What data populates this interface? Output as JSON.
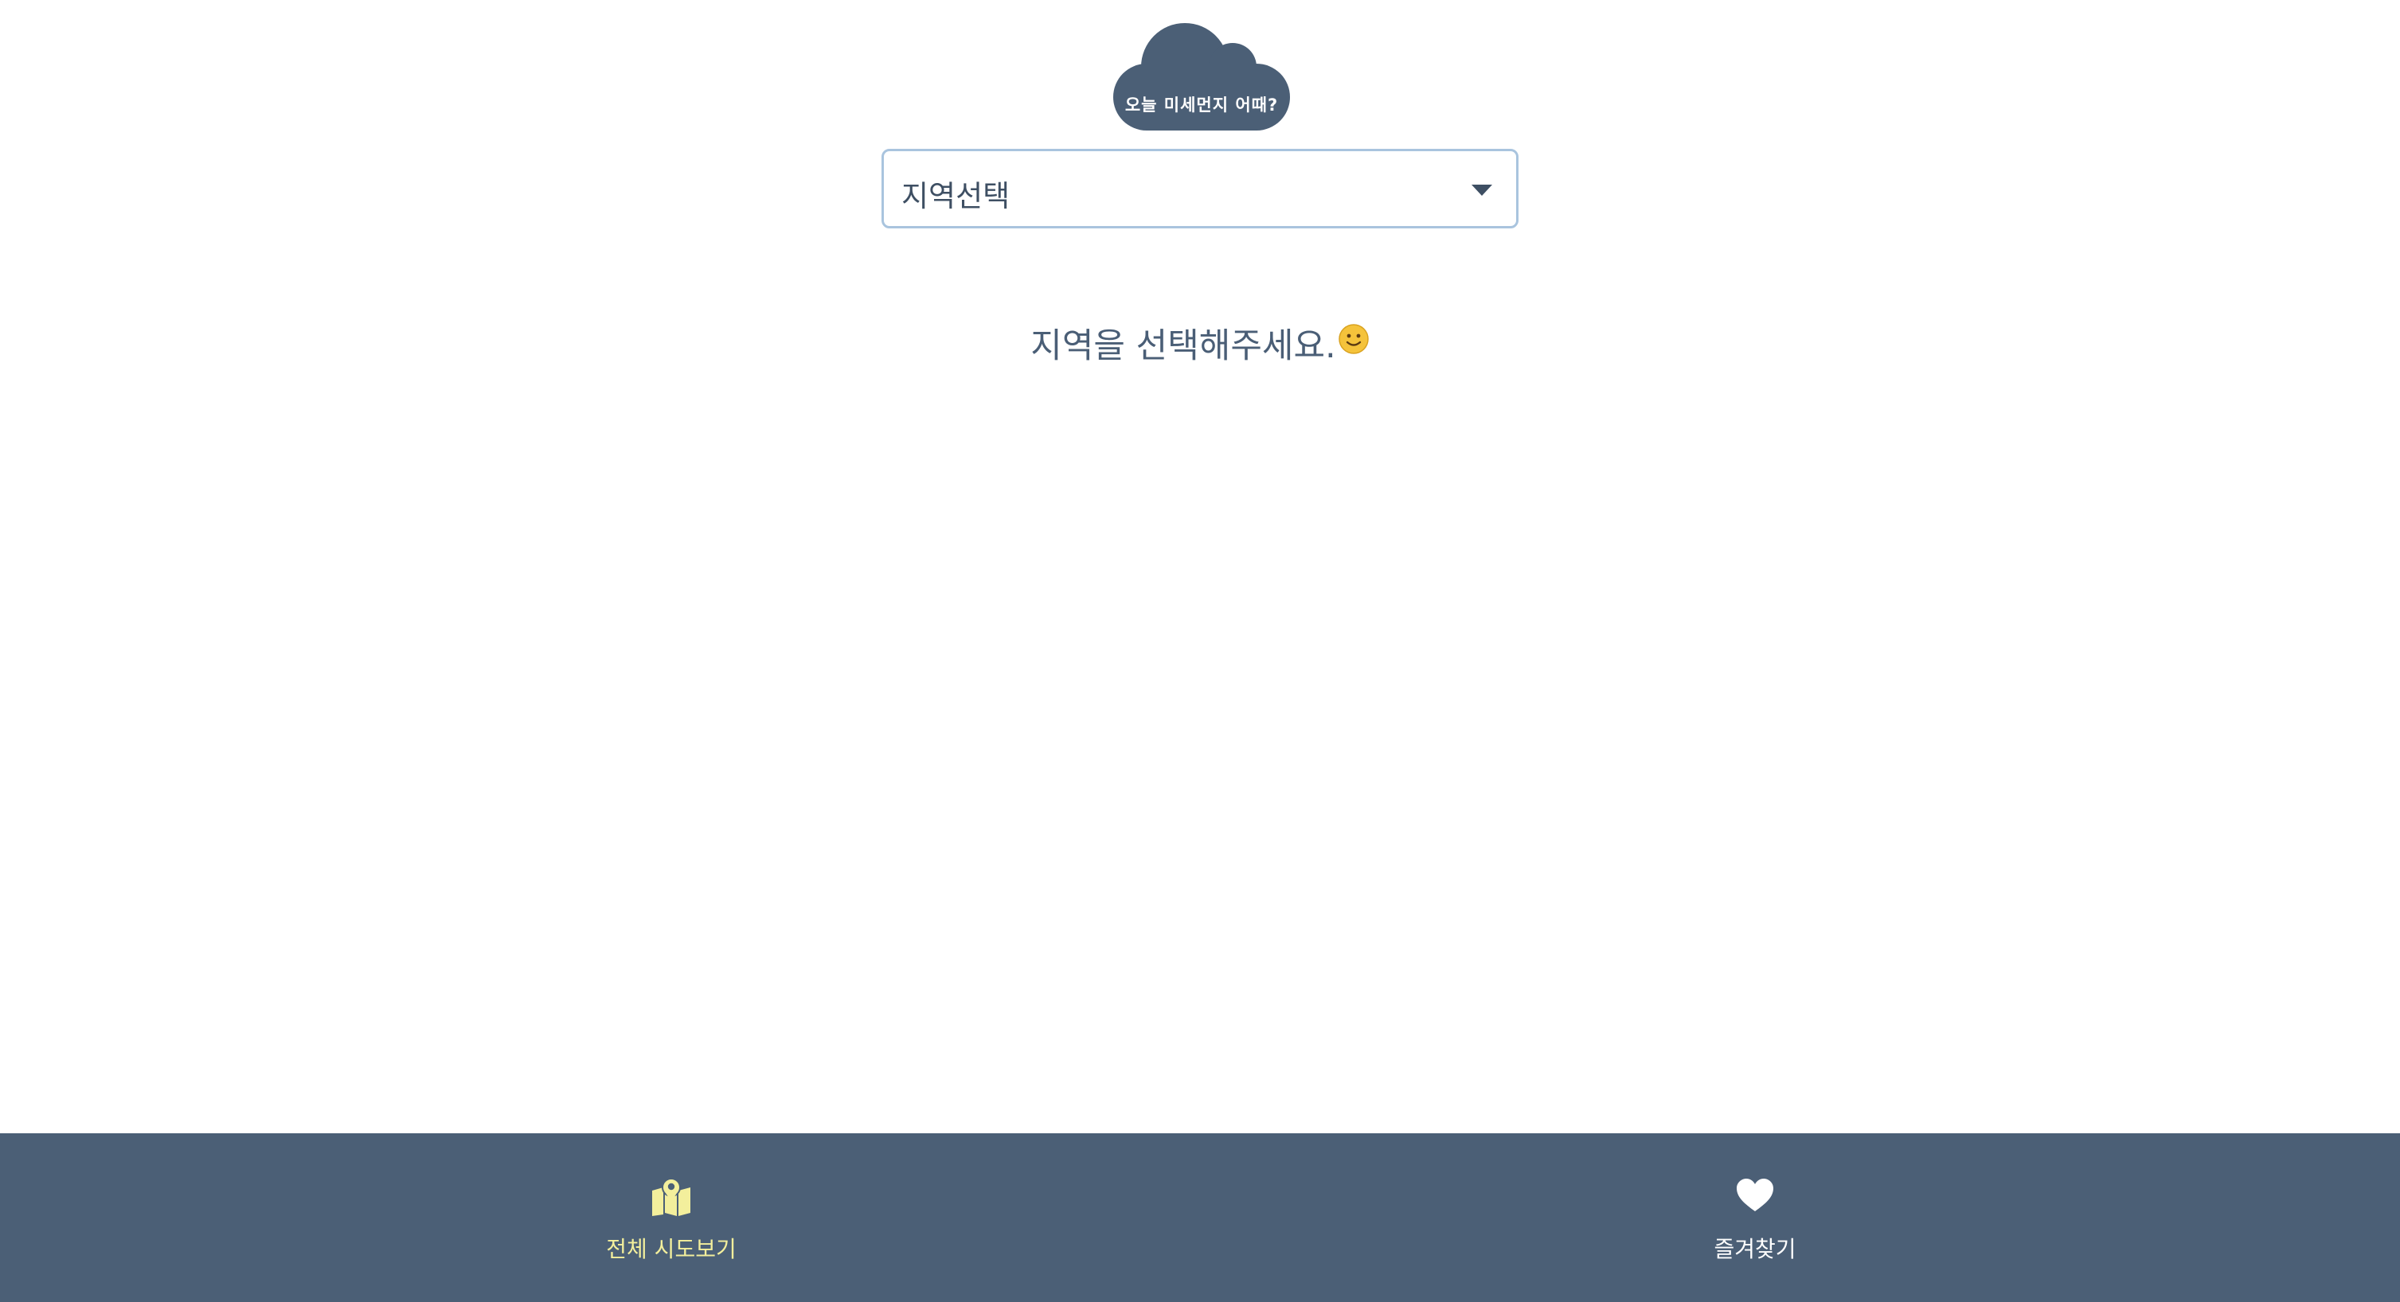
{
  "app": {
    "logo_text": "오늘 미세먼지 어때?"
  },
  "region_select": {
    "value": "지역선택"
  },
  "prompt": {
    "text": "지역을 선택해주세요."
  },
  "bottom_nav": {
    "items": [
      {
        "label": "전체 시도보기",
        "icon": "map-pin-icon",
        "active": true
      },
      {
        "label": "즐겨찾기",
        "icon": "heart-icon",
        "active": false
      }
    ]
  },
  "colors": {
    "primary": "#4b5f76",
    "active_nav": "#f3ef9c",
    "select_border": "#a9c4de",
    "text": "#4a5e76"
  }
}
